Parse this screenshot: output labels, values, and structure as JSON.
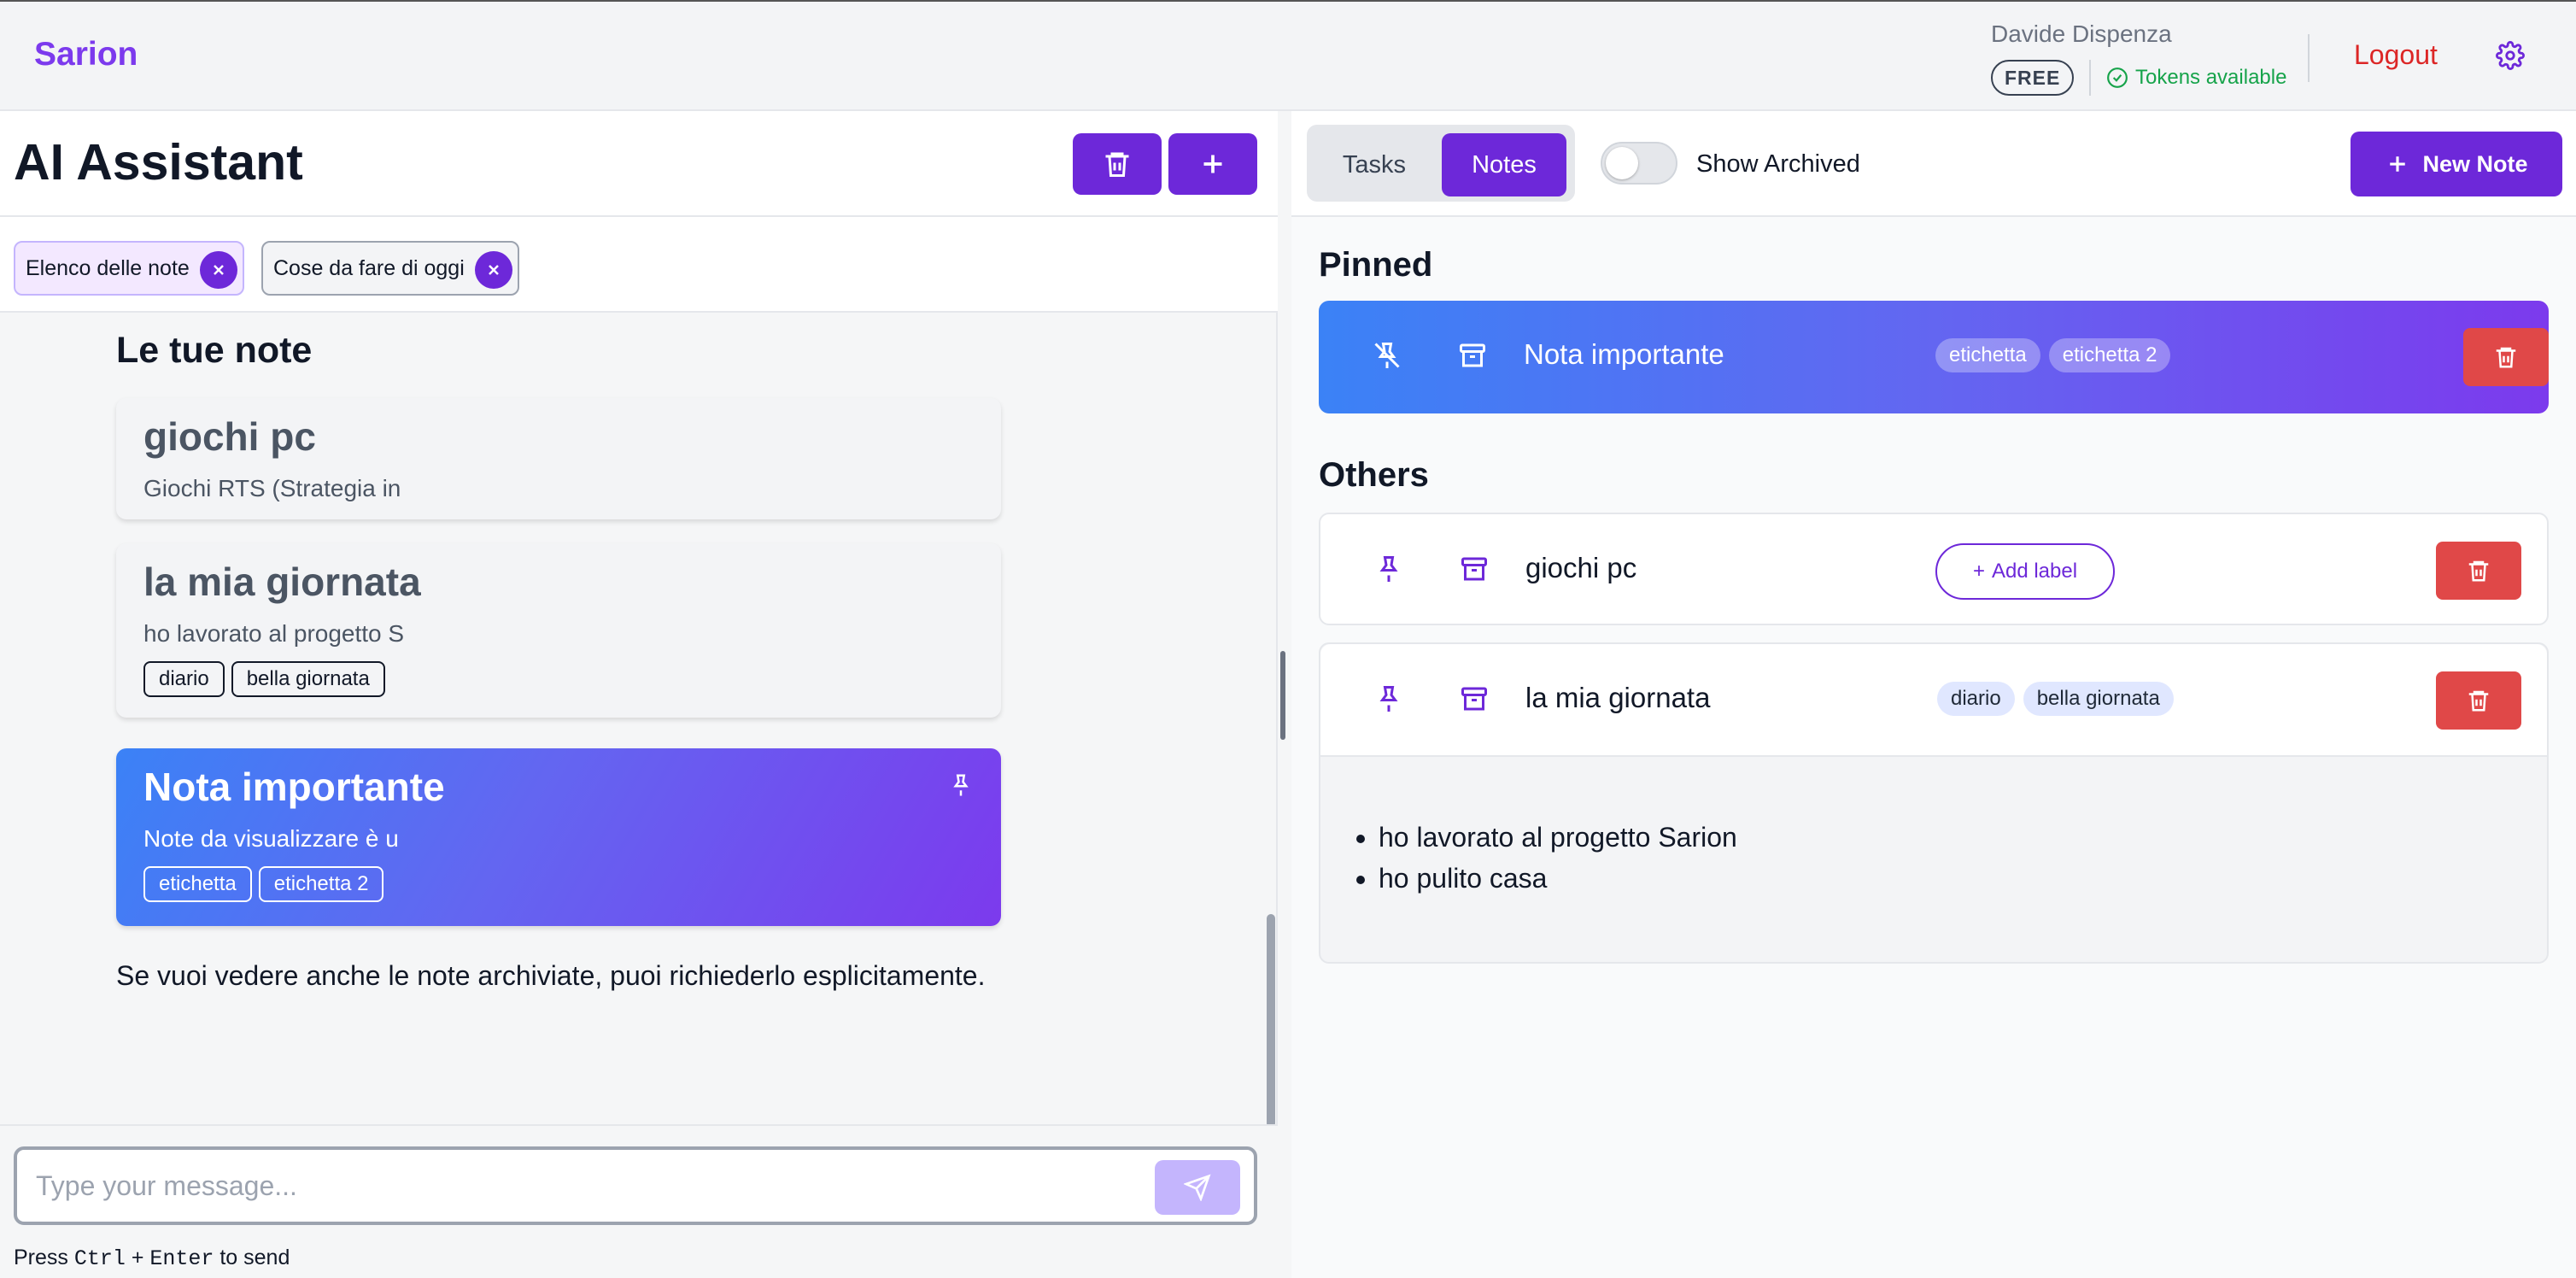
{
  "app": {
    "brand": "Sarion",
    "user_name": "Davide Dispenza",
    "plan": "FREE",
    "tokens_status": "Tokens available",
    "logout_label": "Logout"
  },
  "assistant": {
    "title": "AI Assistant",
    "context_chips": [
      {
        "label": "Elenco delle note"
      },
      {
        "label": "Cose da fare di oggi"
      }
    ],
    "message": {
      "heading": "Le tue note",
      "notes": [
        {
          "title": "giochi pc",
          "preview": "Giochi RTS (Strategia in",
          "tags": []
        },
        {
          "title": "la mia giornata",
          "preview": "ho lavorato al progetto S",
          "tags": [
            "diario",
            "bella giornata"
          ]
        },
        {
          "title": "Nota importante",
          "preview": "Note da visualizzare è u",
          "tags": [
            "etichetta",
            "etichetta 2"
          ],
          "pinned": true
        }
      ],
      "footer": "Se vuoi vedere anche le note archiviate, puoi richiederlo esplicitamente."
    },
    "composer": {
      "placeholder": "Type your message...",
      "hint_prefix": "Press ",
      "hint_key1": "Ctrl",
      "hint_plus": " + ",
      "hint_key2": "Enter",
      "hint_suffix": " to send"
    }
  },
  "notes_panel": {
    "tabs": [
      {
        "label": "Tasks",
        "active": false
      },
      {
        "label": "Notes",
        "active": true
      }
    ],
    "show_archived_label": "Show Archived",
    "show_archived": false,
    "new_note_label": "New Note",
    "pinned_title": "Pinned",
    "others_title": "Others",
    "pinned": [
      {
        "title": "Nota importante",
        "tags": [
          "etichetta",
          "etichetta 2"
        ]
      }
    ],
    "others": [
      {
        "title": "giochi pc",
        "tags": [],
        "add_label": "Add label"
      },
      {
        "title": "la mia giornata",
        "tags": [
          "diario",
          "bella giornata"
        ],
        "expanded": true,
        "content": [
          "ho lavorato al progetto Sarion",
          "ho pulito casa"
        ]
      }
    ]
  },
  "colors": {
    "accent": "#6d28d9",
    "brand": "#7c3aed",
    "danger": "#e04848",
    "success": "#16a34a"
  }
}
